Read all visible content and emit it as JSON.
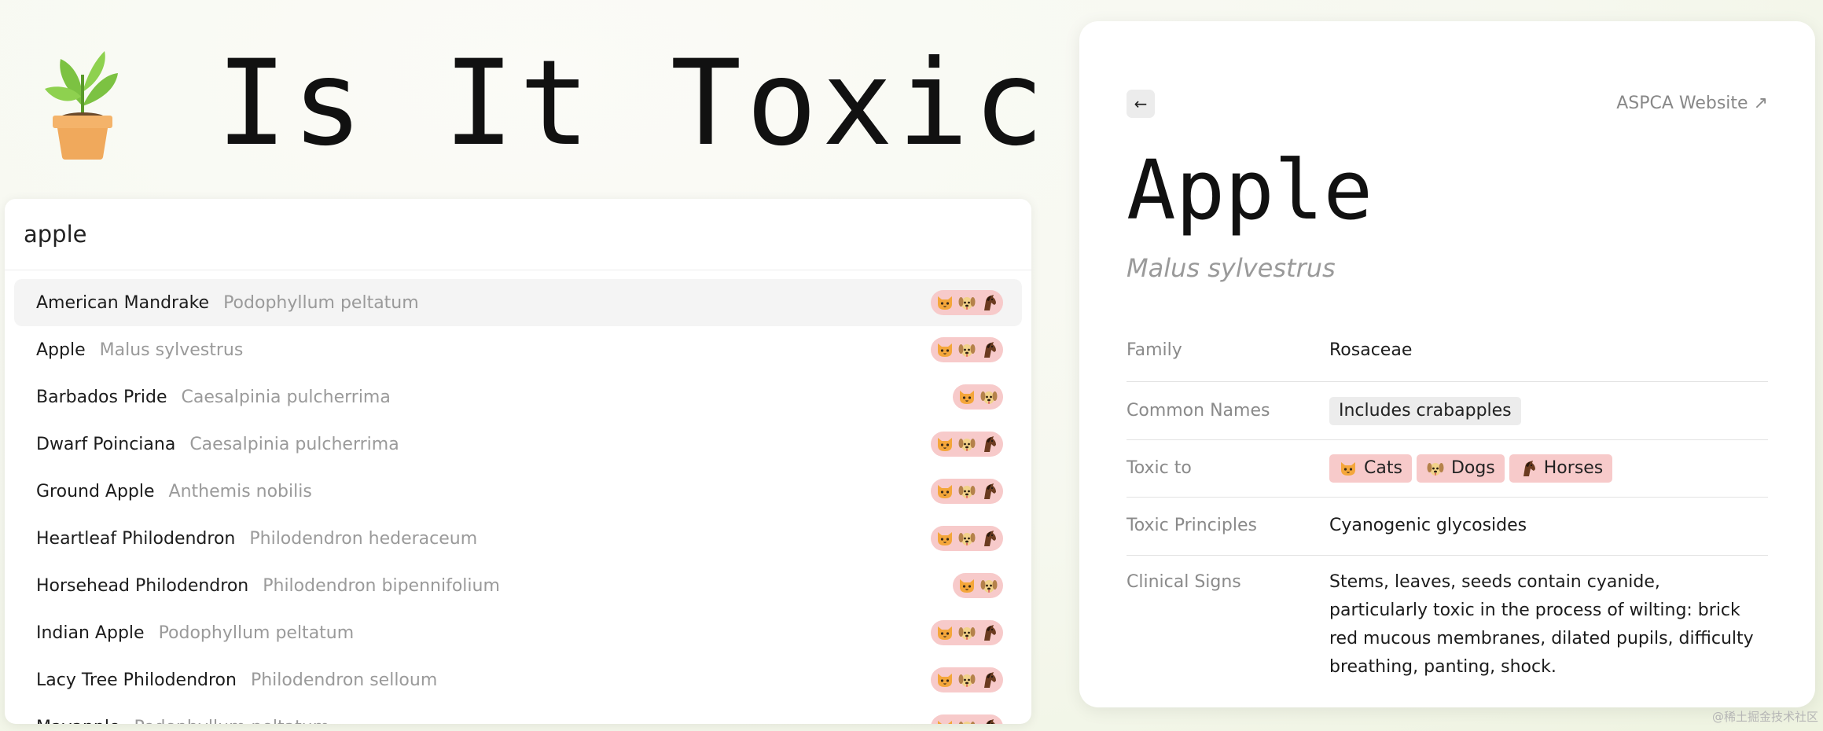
{
  "header": {
    "logo_icon": "potted-plant-icon",
    "title": "Is It Toxic To?"
  },
  "search": {
    "value": "apple",
    "placeholder": ""
  },
  "results": [
    {
      "name": "American Mandrake",
      "latin": "Podophyllum peltatum",
      "toxic_to": [
        "cat",
        "dog",
        "horse"
      ],
      "active": true
    },
    {
      "name": "Apple",
      "latin": "Malus sylvestrus",
      "toxic_to": [
        "cat",
        "dog",
        "horse"
      ]
    },
    {
      "name": "Barbados Pride",
      "latin": "Caesalpinia pulcherrima",
      "toxic_to": [
        "cat",
        "dog"
      ]
    },
    {
      "name": "Dwarf Poinciana",
      "latin": "Caesalpinia pulcherrima",
      "toxic_to": [
        "cat",
        "dog",
        "horse"
      ]
    },
    {
      "name": "Ground Apple",
      "latin": "Anthemis nobilis",
      "toxic_to": [
        "cat",
        "dog",
        "horse"
      ]
    },
    {
      "name": "Heartleaf Philodendron",
      "latin": "Philodendron hederaceum",
      "toxic_to": [
        "cat",
        "dog",
        "horse"
      ]
    },
    {
      "name": "Horsehead Philodendron",
      "latin": "Philodendron bipennifolium",
      "toxic_to": [
        "cat",
        "dog"
      ]
    },
    {
      "name": "Indian Apple",
      "latin": "Podophyllum peltatum",
      "toxic_to": [
        "cat",
        "dog",
        "horse"
      ]
    },
    {
      "name": "Lacy Tree Philodendron",
      "latin": "Philodendron selloum",
      "toxic_to": [
        "cat",
        "dog",
        "horse"
      ]
    },
    {
      "name": "Mayapple",
      "latin": "Podophyllum peltatum",
      "toxic_to": [
        "cat",
        "dog",
        "horse"
      ]
    }
  ],
  "detail": {
    "back_label": "←",
    "aspca_label": "ASPCA Website ↗",
    "name": "Apple",
    "latin": "Malus sylvestrus",
    "family_label": "Family",
    "family": "Rosaceae",
    "common_names_label": "Common Names",
    "common_names": [
      "Includes crabapples"
    ],
    "toxic_to_label": "Toxic to",
    "toxic_to": [
      {
        "animal": "cat",
        "label": "Cats"
      },
      {
        "animal": "dog",
        "label": "Dogs"
      },
      {
        "animal": "horse",
        "label": "Horses"
      }
    ],
    "toxic_principles_label": "Toxic Principles",
    "toxic_principles": "Cyanogenic glycosides",
    "clinical_signs_label": "Clinical Signs",
    "clinical_signs": "Stems, leaves, seeds contain cyanide, particularly toxic in the process of wilting: brick red mucous membranes, dilated pupils, difficulty breathing, panting, shock."
  },
  "colors": {
    "toxic_badge": "#f7caca",
    "tag": "#ececec",
    "muted_text": "#9a9a9a"
  },
  "watermark": "@稀土掘金技术社区"
}
